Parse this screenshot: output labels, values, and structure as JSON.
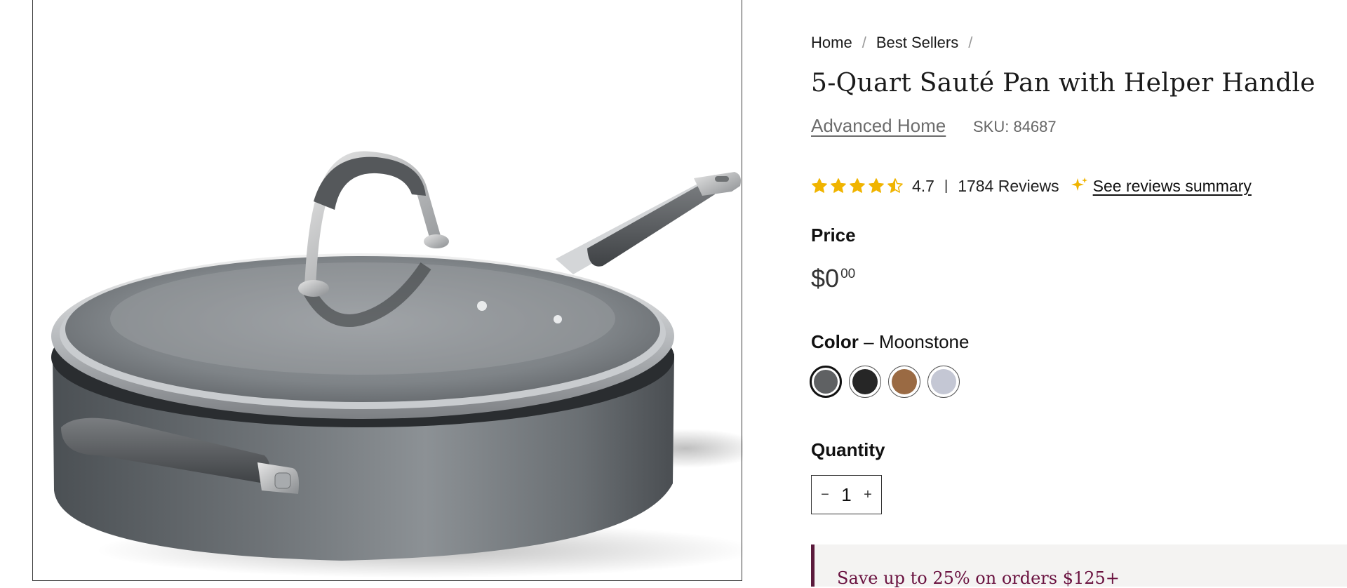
{
  "breadcrumb": {
    "items": [
      "Home",
      "Best Sellers"
    ],
    "separator": "/"
  },
  "product": {
    "title": "5-Quart Sauté Pan with Helper Handle",
    "brand": "Advanced Home",
    "sku": "SKU: 84687",
    "image_alt": "5-quart saute pan with glass lid in moonstone gray"
  },
  "rating": {
    "value": "4.7",
    "separator": "|",
    "stars_filled": 4.5,
    "stars_max": 5,
    "star_color": "#f0b400",
    "reviews": "1784 Reviews",
    "summary_link": "See reviews summary",
    "sparkle_icon": "sparkle-icon"
  },
  "price": {
    "label": "Price",
    "currency": "$",
    "whole": "0",
    "cents": "00"
  },
  "color": {
    "label": "Color",
    "separator": "–",
    "selected": "Moonstone",
    "swatches": [
      {
        "color": "#5f6163",
        "selected": true
      },
      {
        "color": "#262626",
        "selected": false
      },
      {
        "color": "#9a6a43",
        "selected": false
      },
      {
        "color": "#c4c7d4",
        "selected": false
      }
    ]
  },
  "quantity": {
    "label": "Quantity",
    "value": "1",
    "decrement": "−",
    "increment": "+"
  },
  "promo": {
    "text": "Save up to 25% on orders $125+",
    "accent": "#5b1a3c"
  }
}
